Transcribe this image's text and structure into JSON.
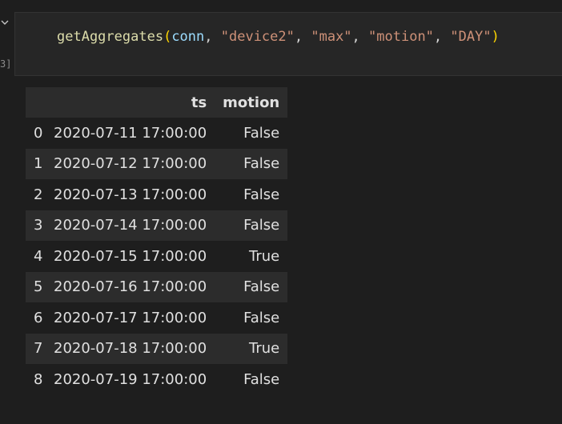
{
  "cell": {
    "execution_count": "3]",
    "code": {
      "function": "getAggregates",
      "open_paren": "(",
      "arg_var": "conn",
      "sep1": ", ",
      "arg1": "\"device2\"",
      "sep2": ", ",
      "arg2": "\"max\"",
      "sep3": ", ",
      "arg3": "\"motion\"",
      "sep4": ", ",
      "arg4": "\"DAY\"",
      "close_paren": ")"
    }
  },
  "output": {
    "columns": [
      "",
      "ts",
      "motion"
    ],
    "rows": [
      {
        "index": "0",
        "ts": "2020-07-11 17:00:00",
        "motion": "False"
      },
      {
        "index": "1",
        "ts": "2020-07-12 17:00:00",
        "motion": "False"
      },
      {
        "index": "2",
        "ts": "2020-07-13 17:00:00",
        "motion": "False"
      },
      {
        "index": "3",
        "ts": "2020-07-14 17:00:00",
        "motion": "False"
      },
      {
        "index": "4",
        "ts": "2020-07-15 17:00:00",
        "motion": "True"
      },
      {
        "index": "5",
        "ts": "2020-07-16 17:00:00",
        "motion": "False"
      },
      {
        "index": "6",
        "ts": "2020-07-17 17:00:00",
        "motion": "False"
      },
      {
        "index": "7",
        "ts": "2020-07-18 17:00:00",
        "motion": "True"
      },
      {
        "index": "8",
        "ts": "2020-07-19 17:00:00",
        "motion": "False"
      }
    ]
  },
  "icons": {
    "collapse": "chevron-down-icon"
  },
  "colors": {
    "background": "#1e1e1e",
    "cell_background": "#262626",
    "table_stripe": "#2c2c2c",
    "function": "#dcdcaa",
    "string": "#ce9178",
    "variable": "#9cdcfe",
    "bracket": "#ffd700"
  }
}
